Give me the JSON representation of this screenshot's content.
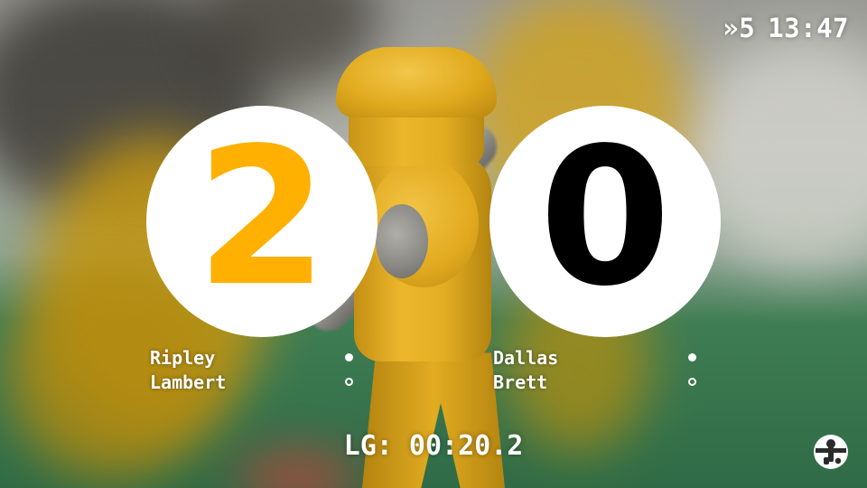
{
  "status": {
    "round_symbol": "»",
    "round_number": "5",
    "clock": "13:47"
  },
  "scoreboard": {
    "left_score": "2",
    "right_score": "0",
    "left_score_color": "#FFB000",
    "right_score_color": "#000000"
  },
  "teams": {
    "left": [
      {
        "name": "Ripley",
        "indicator": "filled"
      },
      {
        "name": "Lambert",
        "indicator": "open"
      }
    ],
    "right": [
      {
        "name": "Dallas",
        "indicator": "filled"
      },
      {
        "name": "Brett",
        "indicator": "open"
      }
    ]
  },
  "last_goal": {
    "label": "LG:",
    "time": "00:20.2"
  },
  "icons": {
    "logo": "foosball-logo-icon",
    "active_player": "filled-dot-icon",
    "inactive_player": "open-dot-icon"
  }
}
